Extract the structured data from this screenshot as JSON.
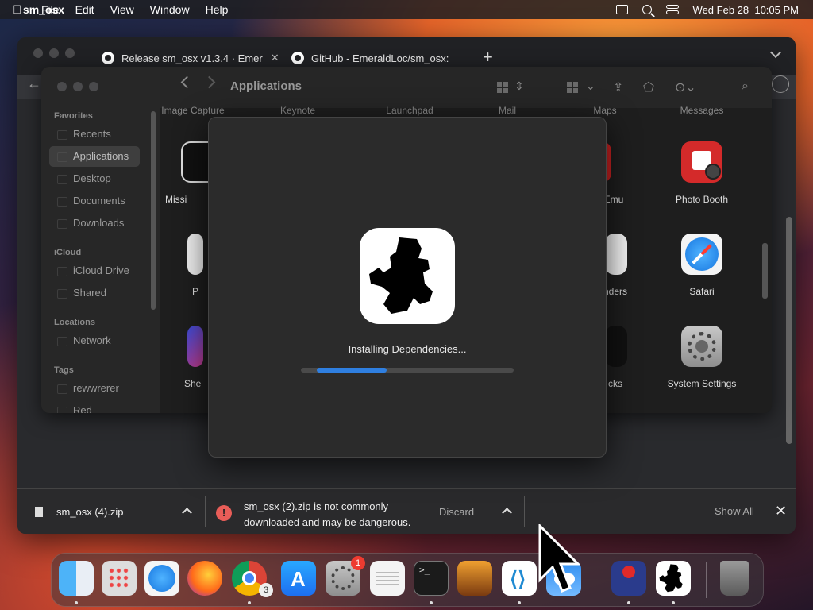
{
  "menubar": {
    "app_name": "sm_osx",
    "menus": [
      "File",
      "Edit",
      "View",
      "Window",
      "Help"
    ],
    "clock": "Wed Feb 28  10:05 PM",
    "status_icons": [
      "windows-icon",
      "search-icon",
      "control-center-icon"
    ]
  },
  "browser": {
    "tabs": [
      {
        "label": "Release sm_osx v1.3.4 · Emer",
        "icon": "github-icon"
      },
      {
        "label": "GitHub - EmeraldLoc/sm_osx:",
        "icon": "github-icon"
      }
    ],
    "new_tab": "+",
    "download_bar": {
      "file_name": "sm_osx (4).zip",
      "warning_line1": "sm_osx (2).zip is not commonly",
      "warning_line2": "downloaded and may be dangerous.",
      "warning_symbol": "!",
      "discard_label": "Discard",
      "show_all_label": "Show All",
      "close_symbol": "✕"
    }
  },
  "finder": {
    "title": "Applications",
    "sidebar": {
      "favorites_label": "Favorites",
      "favorites": [
        "Recents",
        "Applications",
        "Desktop",
        "Documents",
        "Downloads"
      ],
      "selected": "Applications",
      "icloud_label": "iCloud",
      "icloud": [
        "iCloud Drive",
        "Shared"
      ],
      "locations_label": "Locations",
      "locations": [
        "Network"
      ],
      "tags_label": "Tags",
      "tags": [
        "rewwrerer",
        "Red"
      ]
    },
    "top_row_labels": [
      "Image Capture",
      "Keynote",
      "Launchpad",
      "Mail",
      "Maps",
      "Messages"
    ],
    "apps": {
      "mission": "Missi",
      "emu": "nEmu",
      "photo_booth": "Photo Booth",
      "p": "P",
      "reminders": "nders",
      "safari": "Safari",
      "she": "She",
      "stocks": "cks",
      "system_settings": "System Settings"
    }
  },
  "dialog": {
    "status_text": "Installing Dependencies...",
    "progress": 0.33
  },
  "dock": {
    "apps": [
      "finder-icon",
      "launchpad-icon",
      "safari-icon",
      "firefox-icon",
      "chrome-icon",
      "app-store-icon",
      "system-settings-icon",
      "textedit-icon",
      "terminal-icon",
      "garageband-icon",
      "vscode-icon",
      "weather-icon",
      "emulator-icon",
      "sm-osx-icon",
      "trash-icon"
    ],
    "settings_badge": "1",
    "chrome_badge": "3"
  },
  "colors": {
    "accent_blue": "#2f7fe0",
    "warning_red": "#e85d58",
    "badge_red": "#ee3b30"
  }
}
